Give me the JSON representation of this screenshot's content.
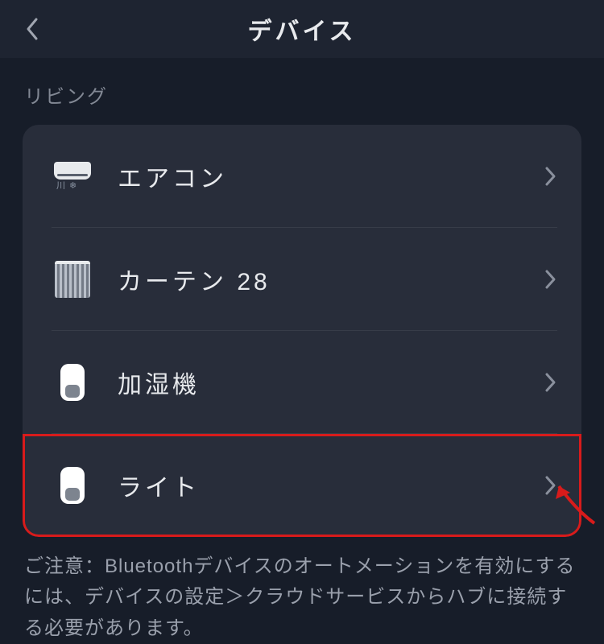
{
  "header": {
    "title": "デバイス"
  },
  "room": {
    "name": "リビング"
  },
  "devices": [
    {
      "id": "ac",
      "label": "エアコン",
      "icon": "ac-icon",
      "highlighted": false
    },
    {
      "id": "curtain",
      "label": "カーテン 28",
      "icon": "curtain-icon",
      "highlighted": false
    },
    {
      "id": "humidifier",
      "label": "加湿機",
      "icon": "bot-icon",
      "highlighted": false
    },
    {
      "id": "light",
      "label": "ライト",
      "icon": "bot-icon",
      "highlighted": true
    }
  ],
  "notice": "ご注意：Bluetoothデバイスのオートメーションを有効にするには、デバイスの設定＞クラウドサービスからハブに接続する必要があります。"
}
